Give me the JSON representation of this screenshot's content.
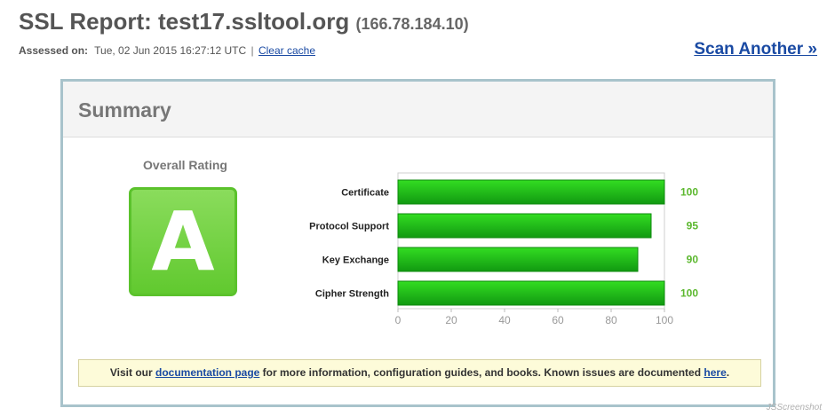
{
  "header": {
    "title_prefix": "SSL Report: ",
    "host": "test17.ssltool.org",
    "ip": "(166.78.184.10)",
    "assessed_label": "Assessed on:",
    "assessed_value": "Tue, 02 Jun 2015 16:27:12 UTC",
    "separator": "|",
    "clear_cache": "Clear cache",
    "scan_another": "Scan Another »"
  },
  "summary": {
    "title": "Summary",
    "overall_label": "Overall Rating",
    "grade": "A",
    "grade_color": "#66cc33"
  },
  "chart_data": {
    "type": "bar",
    "orientation": "horizontal",
    "categories": [
      "Certificate",
      "Protocol Support",
      "Key Exchange",
      "Cipher Strength"
    ],
    "values": [
      100,
      95,
      90,
      100
    ],
    "xlim": [
      0,
      100
    ],
    "xticks": [
      0,
      20,
      40,
      60,
      80,
      100
    ],
    "bar_color": "#22bb11",
    "value_label_color": "#5cb82f",
    "grid": false
  },
  "notice": {
    "text_1": "Visit our ",
    "link_1": "documentation page",
    "text_2": " for more information, configuration guides, and books. Known issues are documented ",
    "link_2": "here",
    "text_3": "."
  },
  "watermark": "JSScreenshot"
}
